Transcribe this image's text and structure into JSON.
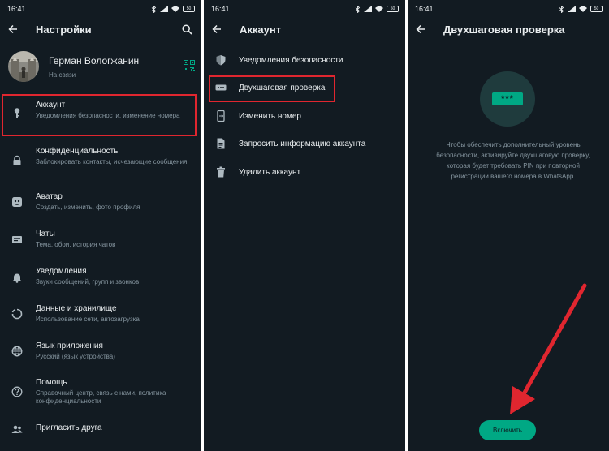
{
  "colors": {
    "bg": "#121b22",
    "accent": "#00a884",
    "highlight": "#e0262f",
    "text": "#e9edef",
    "subtext": "#8696a0"
  },
  "status": {
    "time": "16:41",
    "battery": "50"
  },
  "settings": {
    "title": "Настройки",
    "profile": {
      "name": "Герман Вологжанин",
      "status": "На связи"
    },
    "items": [
      {
        "title": "Аккаунт",
        "subtitle": "Уведомления безопасности, изменение номера",
        "icon": "key-icon"
      },
      {
        "title": "Конфиденциальность",
        "subtitle": "Заблокировать контакты, исчезающие сообщения",
        "icon": "lock-icon"
      },
      {
        "title": "Аватар",
        "subtitle": "Создать, изменить, фото профиля",
        "icon": "avatar-icon"
      },
      {
        "title": "Чаты",
        "subtitle": "Тема, обои, история чатов",
        "icon": "chat-icon"
      },
      {
        "title": "Уведомления",
        "subtitle": "Звуки сообщений, групп и звонков",
        "icon": "bell-icon"
      },
      {
        "title": "Данные и хранилище",
        "subtitle": "Использование сети, автозагрузка",
        "icon": "data-icon"
      },
      {
        "title": "Язык приложения",
        "subtitle": "Русский (язык устройства)",
        "icon": "globe-icon"
      },
      {
        "title": "Помощь",
        "subtitle": "Справочный центр, связь с нами, политика конфиденциальности",
        "icon": "help-icon"
      },
      {
        "title": "Пригласить друга",
        "subtitle": "",
        "icon": "people-icon"
      }
    ]
  },
  "account": {
    "title": "Аккаунт",
    "items": [
      {
        "label": "Уведомления безопасности",
        "icon": "shield-icon"
      },
      {
        "label": "Двухшаговая проверка",
        "icon": "pin-dots-icon"
      },
      {
        "label": "Изменить номер",
        "icon": "change-number-icon"
      },
      {
        "label": "Запросить информацию аккаунта",
        "icon": "document-icon"
      },
      {
        "label": "Удалить аккаунт",
        "icon": "trash-icon"
      }
    ]
  },
  "two_step": {
    "title": "Двухшаговая проверка",
    "pin_mask": "***",
    "description": "Чтобы обеспечить дополнительный уровень безопасности, активируйте двухшаговую проверку, которая будет требовать PIN при повторной регистрации вашего номера в WhatsApp.",
    "enable_label": "Включить"
  }
}
